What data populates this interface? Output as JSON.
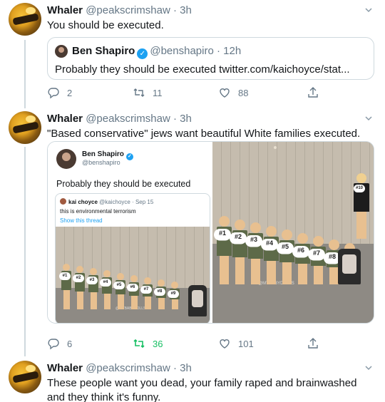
{
  "tweets": [
    {
      "author": {
        "name": "Whaler",
        "handle": "@peakscrimshaw",
        "time": "3h"
      },
      "text": "You should be executed.",
      "quote": {
        "name": "Ben Shapiro",
        "handle": "@benshapiro",
        "time": "12h",
        "text": "Probably they should be executed twitter.com/kaichoyce/stat..."
      },
      "actions": {
        "replies": "2",
        "retweets": "11",
        "likes": "88"
      }
    },
    {
      "author": {
        "name": "Whaler",
        "handle": "@peakscrimshaw",
        "time": "3h"
      },
      "text": "\"Based conservative\" jews want beautiful White families executed.",
      "screenshot": {
        "name": "Ben Shapiro",
        "handle": "@benshapiro",
        "text": "Probably they should be executed",
        "inner_quote": {
          "name": "kai choyce",
          "handle": "@kaichoyce",
          "date": "Sep 15",
          "text": "this is environmental terrorism",
          "link": "Show this thread"
        },
        "watermark": "@MYBABYDOLLS"
      },
      "photo": {
        "watermark": "@MYBABYDOLLS"
      },
      "kid_tags": [
        "#1",
        "#2",
        "#3",
        "#4",
        "#5",
        "#6",
        "#7",
        "#8",
        "#9",
        "#10"
      ],
      "actions": {
        "replies": "6",
        "retweets": "36",
        "likes": "101"
      }
    },
    {
      "author": {
        "name": "Whaler",
        "handle": "@peakscrimshaw",
        "time": "3h"
      },
      "text": "These people want you dead, your family raped and brainwashed and they think it's funny."
    }
  ],
  "colors": {
    "retweet_active": "#17bf63",
    "verified": "#1da1f2",
    "muted": "#657786"
  }
}
